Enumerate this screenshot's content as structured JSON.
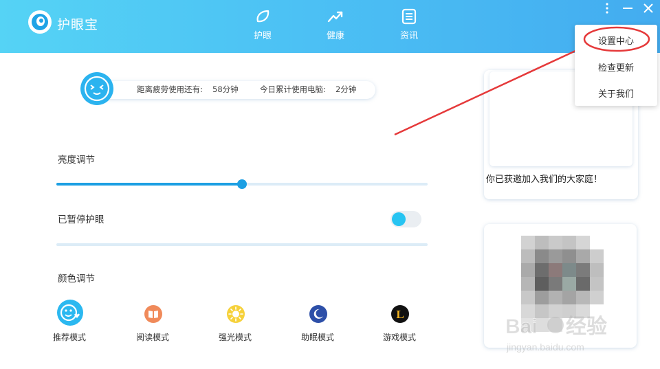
{
  "app": {
    "title": "护眼宝"
  },
  "nav": {
    "tabs": [
      {
        "label": "护眼",
        "icon": "leaf-icon"
      },
      {
        "label": "健康",
        "icon": "trend-chart-icon"
      },
      {
        "label": "资讯",
        "icon": "news-icon"
      }
    ]
  },
  "window_controls": {
    "icons": [
      "more-icon",
      "minimize-icon",
      "close-icon"
    ]
  },
  "menu": {
    "items": [
      {
        "label": "设置中心",
        "highlighted": true
      },
      {
        "label": "检查更新"
      },
      {
        "label": "关于我们"
      }
    ]
  },
  "status": {
    "fatigue_label": "距离疲劳使用还有:",
    "fatigue_value": "58分钟",
    "today_label": "今日累计使用电脑:",
    "today_value": "2分钟"
  },
  "brightness": {
    "title": "亮度调节",
    "value_percent": 50
  },
  "eye_protection": {
    "title": "已暂停护眼",
    "enabled": false
  },
  "color": {
    "title": "颜色调节",
    "modes": [
      {
        "label": "推荐模式",
        "icon": "smile-face-icon",
        "color": "#2bb8f0"
      },
      {
        "label": "阅读模式",
        "icon": "book-icon",
        "color": "#f08a5a"
      },
      {
        "label": "强光模式",
        "icon": "sun-icon",
        "color": "#f6d13a"
      },
      {
        "label": "助眠模式",
        "icon": "moon-icon",
        "color": "#2d4fa8"
      },
      {
        "label": "游戏模式",
        "icon": "game-l-icon",
        "color": "#111111"
      }
    ]
  },
  "side": {
    "invite_text": "你已获邀加入我们的大家庭！"
  },
  "watermark": {
    "text": "Baidu经验",
    "url_text": "jingyan.baidu.com"
  },
  "colors": {
    "header_start": "#55d3f5",
    "header_end": "#43acf0",
    "accent": "#1c9fe3",
    "annotation_red": "#e5393a"
  }
}
